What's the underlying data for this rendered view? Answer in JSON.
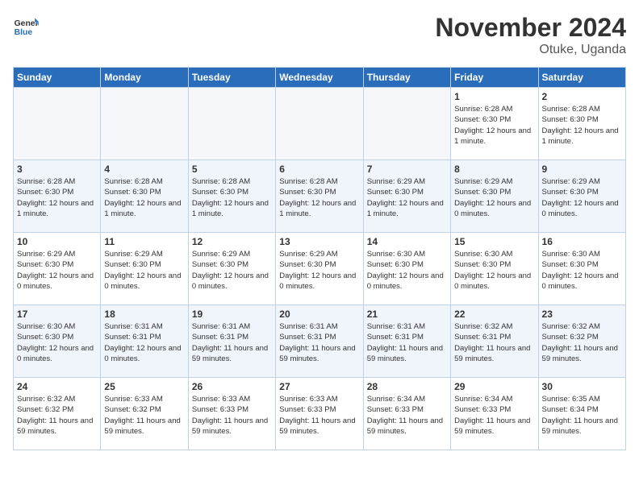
{
  "header": {
    "logo_line1": "General",
    "logo_line2": "Blue",
    "title": "November 2024",
    "location": "Otuke, Uganda"
  },
  "days_of_week": [
    "Sunday",
    "Monday",
    "Tuesday",
    "Wednesday",
    "Thursday",
    "Friday",
    "Saturday"
  ],
  "weeks": [
    [
      {
        "day": "",
        "info": ""
      },
      {
        "day": "",
        "info": ""
      },
      {
        "day": "",
        "info": ""
      },
      {
        "day": "",
        "info": ""
      },
      {
        "day": "",
        "info": ""
      },
      {
        "day": "1",
        "info": "Sunrise: 6:28 AM\nSunset: 6:30 PM\nDaylight: 12 hours and 1 minute."
      },
      {
        "day": "2",
        "info": "Sunrise: 6:28 AM\nSunset: 6:30 PM\nDaylight: 12 hours and 1 minute."
      }
    ],
    [
      {
        "day": "3",
        "info": "Sunrise: 6:28 AM\nSunset: 6:30 PM\nDaylight: 12 hours and 1 minute."
      },
      {
        "day": "4",
        "info": "Sunrise: 6:28 AM\nSunset: 6:30 PM\nDaylight: 12 hours and 1 minute."
      },
      {
        "day": "5",
        "info": "Sunrise: 6:28 AM\nSunset: 6:30 PM\nDaylight: 12 hours and 1 minute."
      },
      {
        "day": "6",
        "info": "Sunrise: 6:28 AM\nSunset: 6:30 PM\nDaylight: 12 hours and 1 minute."
      },
      {
        "day": "7",
        "info": "Sunrise: 6:29 AM\nSunset: 6:30 PM\nDaylight: 12 hours and 1 minute."
      },
      {
        "day": "8",
        "info": "Sunrise: 6:29 AM\nSunset: 6:30 PM\nDaylight: 12 hours and 0 minutes."
      },
      {
        "day": "9",
        "info": "Sunrise: 6:29 AM\nSunset: 6:30 PM\nDaylight: 12 hours and 0 minutes."
      }
    ],
    [
      {
        "day": "10",
        "info": "Sunrise: 6:29 AM\nSunset: 6:30 PM\nDaylight: 12 hours and 0 minutes."
      },
      {
        "day": "11",
        "info": "Sunrise: 6:29 AM\nSunset: 6:30 PM\nDaylight: 12 hours and 0 minutes."
      },
      {
        "day": "12",
        "info": "Sunrise: 6:29 AM\nSunset: 6:30 PM\nDaylight: 12 hours and 0 minutes."
      },
      {
        "day": "13",
        "info": "Sunrise: 6:29 AM\nSunset: 6:30 PM\nDaylight: 12 hours and 0 minutes."
      },
      {
        "day": "14",
        "info": "Sunrise: 6:30 AM\nSunset: 6:30 PM\nDaylight: 12 hours and 0 minutes."
      },
      {
        "day": "15",
        "info": "Sunrise: 6:30 AM\nSunset: 6:30 PM\nDaylight: 12 hours and 0 minutes."
      },
      {
        "day": "16",
        "info": "Sunrise: 6:30 AM\nSunset: 6:30 PM\nDaylight: 12 hours and 0 minutes."
      }
    ],
    [
      {
        "day": "17",
        "info": "Sunrise: 6:30 AM\nSunset: 6:30 PM\nDaylight: 12 hours and 0 minutes."
      },
      {
        "day": "18",
        "info": "Sunrise: 6:31 AM\nSunset: 6:31 PM\nDaylight: 12 hours and 0 minutes."
      },
      {
        "day": "19",
        "info": "Sunrise: 6:31 AM\nSunset: 6:31 PM\nDaylight: 11 hours and 59 minutes."
      },
      {
        "day": "20",
        "info": "Sunrise: 6:31 AM\nSunset: 6:31 PM\nDaylight: 11 hours and 59 minutes."
      },
      {
        "day": "21",
        "info": "Sunrise: 6:31 AM\nSunset: 6:31 PM\nDaylight: 11 hours and 59 minutes."
      },
      {
        "day": "22",
        "info": "Sunrise: 6:32 AM\nSunset: 6:31 PM\nDaylight: 11 hours and 59 minutes."
      },
      {
        "day": "23",
        "info": "Sunrise: 6:32 AM\nSunset: 6:32 PM\nDaylight: 11 hours and 59 minutes."
      }
    ],
    [
      {
        "day": "24",
        "info": "Sunrise: 6:32 AM\nSunset: 6:32 PM\nDaylight: 11 hours and 59 minutes."
      },
      {
        "day": "25",
        "info": "Sunrise: 6:33 AM\nSunset: 6:32 PM\nDaylight: 11 hours and 59 minutes."
      },
      {
        "day": "26",
        "info": "Sunrise: 6:33 AM\nSunset: 6:33 PM\nDaylight: 11 hours and 59 minutes."
      },
      {
        "day": "27",
        "info": "Sunrise: 6:33 AM\nSunset: 6:33 PM\nDaylight: 11 hours and 59 minutes."
      },
      {
        "day": "28",
        "info": "Sunrise: 6:34 AM\nSunset: 6:33 PM\nDaylight: 11 hours and 59 minutes."
      },
      {
        "day": "29",
        "info": "Sunrise: 6:34 AM\nSunset: 6:33 PM\nDaylight: 11 hours and 59 minutes."
      },
      {
        "day": "30",
        "info": "Sunrise: 6:35 AM\nSunset: 6:34 PM\nDaylight: 11 hours and 59 minutes."
      }
    ]
  ]
}
